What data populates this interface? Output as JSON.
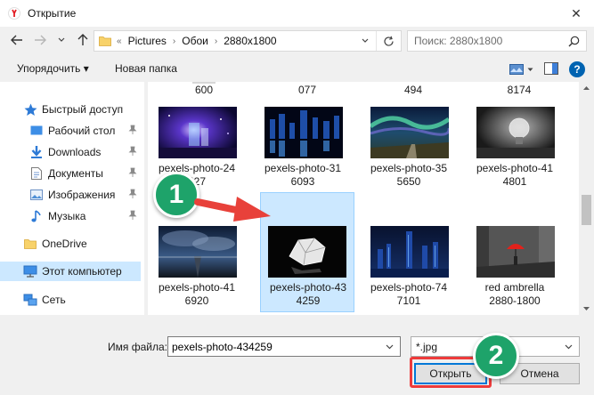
{
  "window": {
    "title": "Открытие",
    "close_glyph": "✕"
  },
  "breadcrumb": {
    "items": [
      "Pictures",
      "Обои",
      "2880x1800"
    ],
    "separator": "›",
    "expander": "«"
  },
  "search": {
    "placeholder": "Поиск: 2880x1800"
  },
  "toolbar": {
    "organize": "Упорядочить ▾",
    "new_folder": "Новая папка",
    "help": "?"
  },
  "sidebar": {
    "items": [
      {
        "label": "Быстрый доступ",
        "icon": "star-icon"
      },
      {
        "label": "Рабочий стол",
        "icon": "desktop-icon",
        "pinned": true
      },
      {
        "label": "Downloads",
        "icon": "download-icon",
        "pinned": true
      },
      {
        "label": "Документы",
        "icon": "document-icon",
        "pinned": true
      },
      {
        "label": "Изображения",
        "icon": "pictures-icon",
        "pinned": true
      },
      {
        "label": "Музыка",
        "icon": "music-icon",
        "pinned": true
      },
      {
        "label": "OneDrive",
        "icon": "folder-icon"
      },
      {
        "label": "Этот компьютер",
        "icon": "computer-icon",
        "selected": true
      },
      {
        "label": "Сеть",
        "icon": "network-icon"
      }
    ]
  },
  "files": {
    "partial_row": [
      "600",
      "077",
      "494",
      "8174"
    ],
    "items": [
      {
        "line1": "pexels-photo-24",
        "line2": "427"
      },
      {
        "line1": "pexels-photo-31",
        "line2": "6093"
      },
      {
        "line1": "pexels-photo-35",
        "line2": "5650"
      },
      {
        "line1": "pexels-photo-41",
        "line2": "4801"
      },
      {
        "line1": "pexels-photo-41",
        "line2": "6920"
      },
      {
        "line1": "pexels-photo-43",
        "line2": "4259",
        "selected": true
      },
      {
        "line1": "pexels-photo-74",
        "line2": "7101"
      },
      {
        "line1": "red ambrella",
        "line2": "2880-1800"
      }
    ]
  },
  "footer": {
    "filename_label": "Имя файла:",
    "filename_value": "pexels-photo-434259",
    "filter_value": "*.jpg",
    "open_label": "Открыть",
    "cancel_label": "Отмена"
  },
  "annotations": {
    "step1": "1",
    "step2": "2"
  },
  "colors": {
    "selection": "#cce8ff",
    "accent": "#0078d7",
    "badge": "#1ea36a",
    "highlight": "#ee3b3b"
  }
}
